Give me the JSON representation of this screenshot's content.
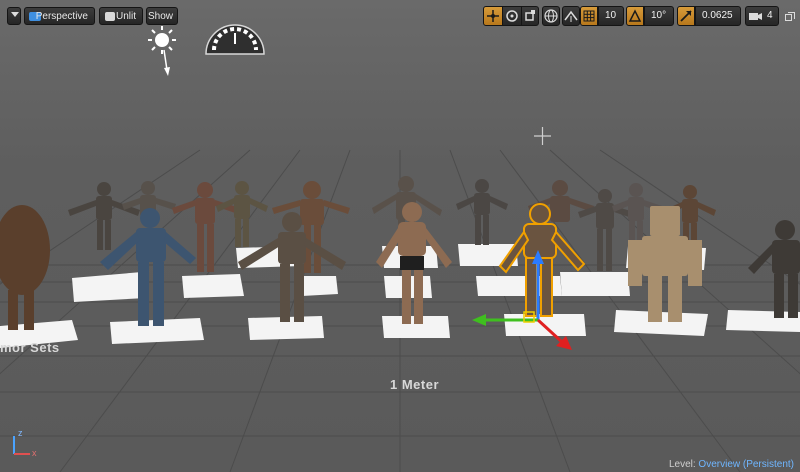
{
  "toolbar": {
    "view_mode": "Perspective",
    "lit_mode": "Unlit",
    "show_label": "Show"
  },
  "snapping": {
    "grid_value": "10",
    "rotation_value": "10°",
    "scale_value": "0.0625",
    "camera_speed": "4"
  },
  "scene": {
    "scale_label": "1 Meter",
    "group_label": "mor Sets"
  },
  "status": {
    "level_prefix": "Level:",
    "level_name": "Overview (Persistent)"
  },
  "axes": {
    "x": "x",
    "z": "z"
  },
  "colors": {
    "accent": "#e8a33a",
    "selection": "#f0a000",
    "link": "#6fb6ff"
  },
  "icons": [
    "perspective-icon",
    "unlit-icon",
    "translate-icon",
    "rotate-icon",
    "scale-icon",
    "world-icon",
    "surface-snap-icon",
    "grid-icon",
    "angle-icon",
    "scale-snap-icon",
    "camera-icon",
    "maximize-icon",
    "sun-icon",
    "horizon-gauge-icon"
  ]
}
